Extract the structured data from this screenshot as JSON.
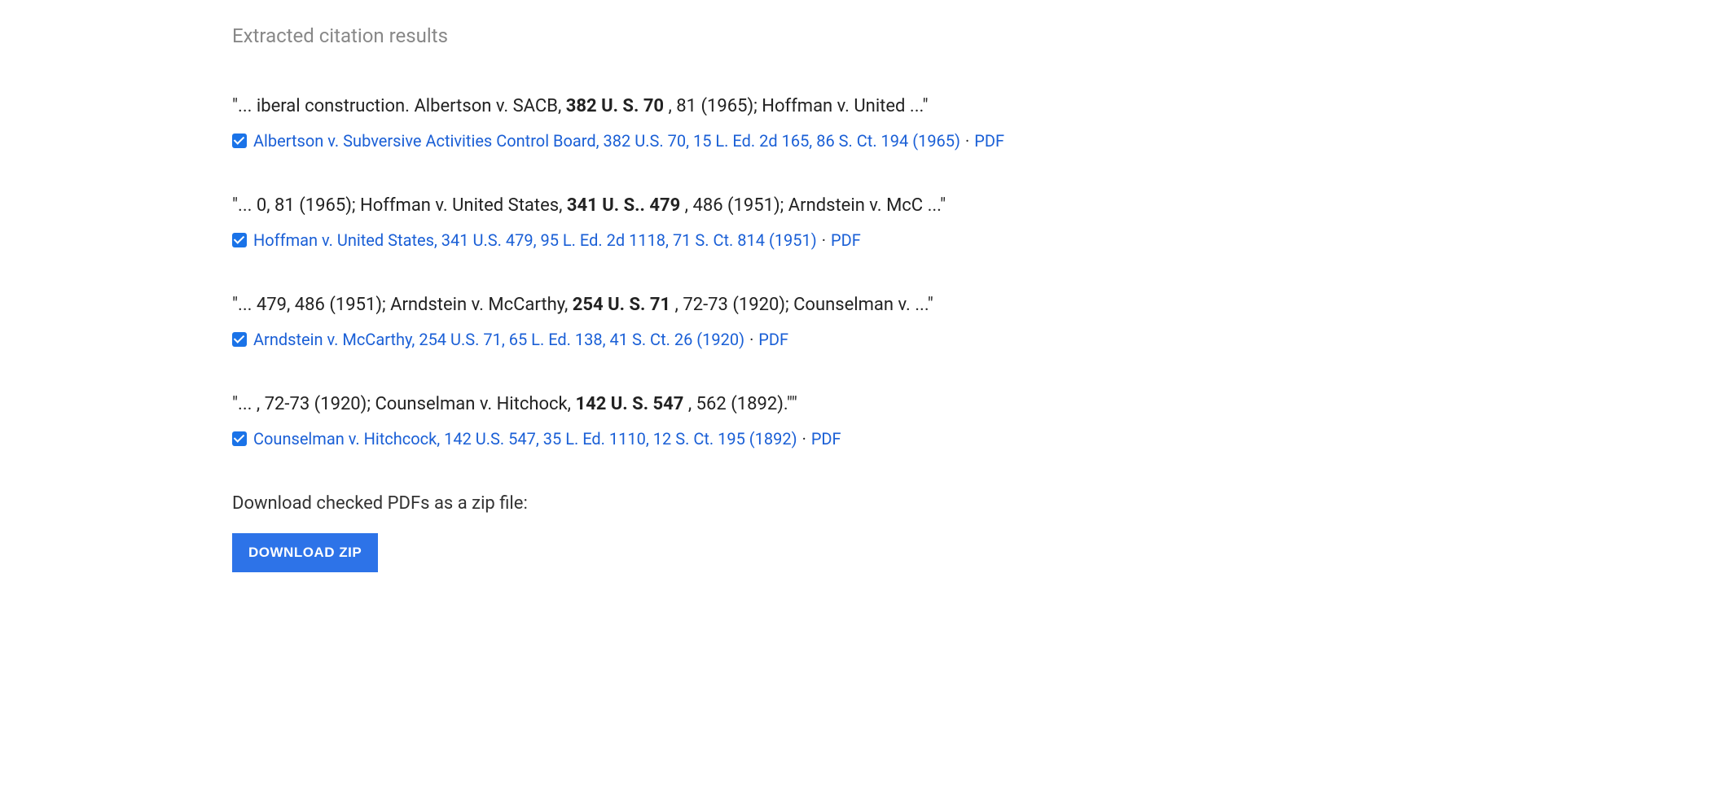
{
  "title": "Extracted citation results",
  "results": [
    {
      "context_prefix": "\"... iberal construction. Albertson v. SACB, ",
      "context_bold": "382 U. S. 70",
      "context_suffix": " , 81 (1965); Hoffman v. United ...\"",
      "checked": true,
      "case_link": "Albertson v. Subversive Activities Control Board, 382 U.S. 70, 15 L. Ed. 2d 165, 86 S. Ct. 194 (1965)",
      "pdf_label": "PDF"
    },
    {
      "context_prefix": "\"... 0, 81 (1965); Hoffman v. United States, ",
      "context_bold": "341 U. S.. 479",
      "context_suffix": " , 486 (1951); Arndstein v. McC ...\"",
      "checked": true,
      "case_link": "Hoffman v. United States, 341 U.S. 479, 95 L. Ed. 2d 1118, 71 S. Ct. 814 (1951)",
      "pdf_label": "PDF"
    },
    {
      "context_prefix": "\"... 479, 486 (1951); Arndstein v. McCarthy, ",
      "context_bold": "254 U. S. 71",
      "context_suffix": " , 72-73 (1920); Counselman v. ...\"",
      "checked": true,
      "case_link": "Arndstein v. McCarthy, 254 U.S. 71, 65 L. Ed. 138, 41 S. Ct. 26 (1920)",
      "pdf_label": "PDF"
    },
    {
      "context_prefix": "\"... , 72-73 (1920); Counselman v. Hitchock, ",
      "context_bold": "142 U. S. 547",
      "context_suffix": " , 562 (1892).\"\"",
      "checked": true,
      "case_link": "Counselman v. Hitchcock, 142 U.S. 547, 35 L. Ed. 1110, 12 S. Ct. 195 (1892)",
      "pdf_label": "PDF"
    }
  ],
  "separator": "·",
  "download_prompt": "Download checked PDFs as a zip file:",
  "download_button": "DOWNLOAD ZIP"
}
